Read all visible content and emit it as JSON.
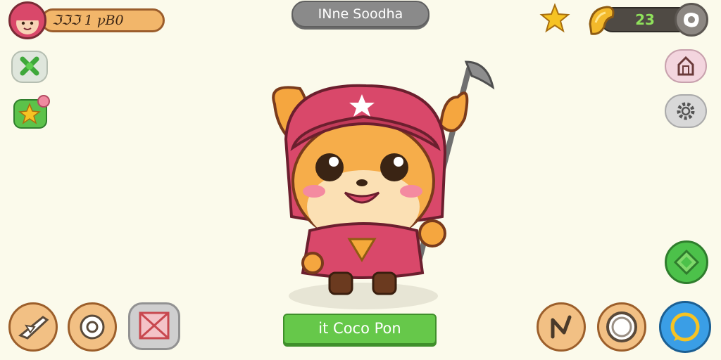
{
  "player": {
    "name_label": "ℑℑℑ 1 ꝩB0"
  },
  "header": {
    "title": "INne Soodha"
  },
  "currency": {
    "amount": "23"
  },
  "character": {
    "name": "Coco Pon",
    "name_prefix": "it"
  },
  "icons": {
    "top_left": "avatar-icon",
    "star": "star-icon",
    "coin": "coin-icon",
    "close": "close-icon",
    "left_side": [
      "leaf-icon",
      "favorite-icon"
    ],
    "right_side": [
      "home-icon",
      "gear-icon",
      "diamond-icon"
    ],
    "bottom_left": [
      "plane-icon",
      "target-icon",
      "cancel-icon"
    ],
    "bottom_right": [
      "back-icon",
      "ring-icon",
      "chat-icon"
    ]
  },
  "colors": {
    "accent_green": "#66c84a",
    "hood_red": "#d9486a",
    "fur_orange": "#f5a63f"
  }
}
